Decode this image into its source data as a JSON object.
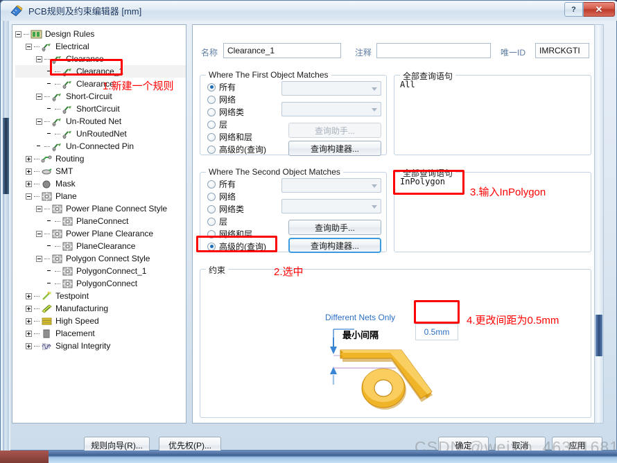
{
  "window": {
    "title": "PCB规则及约束编辑器 [mm]",
    "icon": "ruler-icon",
    "help_label": "?",
    "close_label": "✕"
  },
  "tree": {
    "nodes": [
      {
        "label": "Design Rules",
        "depth": 0,
        "expander": "minus",
        "icon": "design-rules-icon"
      },
      {
        "label": "Electrical",
        "depth": 1,
        "expander": "minus",
        "icon": "electrical-icon"
      },
      {
        "label": "Clearance",
        "depth": 2,
        "expander": "minus",
        "icon": "electrical-icon"
      },
      {
        "label": "Clearance_1",
        "depth": 3,
        "expander": "leaf",
        "icon": "electrical-icon",
        "selected": true
      },
      {
        "label": "Clearance",
        "depth": 3,
        "expander": "leaf",
        "icon": "electrical-icon"
      },
      {
        "label": "Short-Circuit",
        "depth": 2,
        "expander": "minus",
        "icon": "electrical-icon"
      },
      {
        "label": "ShortCircuit",
        "depth": 3,
        "expander": "leaf",
        "icon": "electrical-icon"
      },
      {
        "label": "Un-Routed Net",
        "depth": 2,
        "expander": "minus",
        "icon": "electrical-icon"
      },
      {
        "label": "UnRoutedNet",
        "depth": 3,
        "expander": "leaf",
        "icon": "electrical-icon"
      },
      {
        "label": "Un-Connected Pin",
        "depth": 2,
        "expander": "leaf",
        "icon": "electrical-icon"
      },
      {
        "label": "Routing",
        "depth": 1,
        "expander": "plus",
        "icon": "routing-icon"
      },
      {
        "label": "SMT",
        "depth": 1,
        "expander": "plus",
        "icon": "smt-icon"
      },
      {
        "label": "Mask",
        "depth": 1,
        "expander": "plus",
        "icon": "mask-icon"
      },
      {
        "label": "Plane",
        "depth": 1,
        "expander": "minus",
        "icon": "plane-icon"
      },
      {
        "label": "Power Plane Connect Style",
        "depth": 2,
        "expander": "minus",
        "icon": "plane-icon"
      },
      {
        "label": "PlaneConnect",
        "depth": 3,
        "expander": "leaf",
        "icon": "plane-icon"
      },
      {
        "label": "Power Plane Clearance",
        "depth": 2,
        "expander": "minus",
        "icon": "plane-icon"
      },
      {
        "label": "PlaneClearance",
        "depth": 3,
        "expander": "leaf",
        "icon": "plane-icon"
      },
      {
        "label": "Polygon Connect Style",
        "depth": 2,
        "expander": "minus",
        "icon": "plane-icon"
      },
      {
        "label": "PolygonConnect_1",
        "depth": 3,
        "expander": "leaf",
        "icon": "plane-icon"
      },
      {
        "label": "PolygonConnect",
        "depth": 3,
        "expander": "leaf",
        "icon": "plane-icon"
      },
      {
        "label": "Testpoint",
        "depth": 1,
        "expander": "plus",
        "icon": "testpoint-icon"
      },
      {
        "label": "Manufacturing",
        "depth": 1,
        "expander": "plus",
        "icon": "manufacturing-icon"
      },
      {
        "label": "High Speed",
        "depth": 1,
        "expander": "plus",
        "icon": "highspeed-icon"
      },
      {
        "label": "Placement",
        "depth": 1,
        "expander": "plus",
        "icon": "placement-icon"
      },
      {
        "label": "Signal Integrity",
        "depth": 1,
        "expander": "plus",
        "icon": "signal-icon"
      }
    ]
  },
  "header": {
    "name_label": "名称",
    "name_value": "Clearance_1",
    "comment_label": "注释",
    "comment_value": "",
    "comment_placeholder": "",
    "uid_label": "唯一ID",
    "uid_value": "IMRCKGTI"
  },
  "first_object": {
    "title": "Where The First Object Matches",
    "options": [
      "所有",
      "网络",
      "网络类",
      "层",
      "网络和层",
      "高级的(查询)"
    ],
    "selected_index": 0,
    "net_combo_value": "",
    "netclass_combo_value": "",
    "query_helper_label": "查询助手...",
    "query_builder_label": "查询构建器..."
  },
  "second_object": {
    "title": "Where The Second Object Matches",
    "options": [
      "所有",
      "网络",
      "网络类",
      "层",
      "网络和层",
      "高级的(查询)"
    ],
    "selected_index": 5,
    "net_combo_value": "",
    "netclass_combo_value": "",
    "query_helper_label": "查询助手...",
    "query_builder_label": "查询构建器..."
  },
  "query_first": {
    "title": "全部查询语句",
    "text": "All"
  },
  "query_second": {
    "title": "全部查询语句",
    "text": "InPolygon"
  },
  "constraint": {
    "title": "约束",
    "different_nets_label": "Different Nets Only",
    "min_clearance_label": "最小间隔",
    "value": "0.5mm"
  },
  "annotations": [
    {
      "id": "anno-1",
      "text": "1.新建一个规则"
    },
    {
      "id": "anno-2",
      "text": "2.选中"
    },
    {
      "id": "anno-3",
      "text": "3.输入InPolygon"
    },
    {
      "id": "anno-4",
      "text": "4.更改间距为0.5mm"
    }
  ],
  "footer": {
    "rule_wizard_label": "规则向导(R)...",
    "priority_label": "优先权(P)...",
    "ok_label": "确定",
    "cancel_label": "取消",
    "apply_label": "应用"
  },
  "watermark": "CSDN @weixin_46391681",
  "colors": {
    "annotation_red": "#fe0000",
    "accent_blue": "#2a6fc4",
    "track_gold": "#f0b429"
  }
}
